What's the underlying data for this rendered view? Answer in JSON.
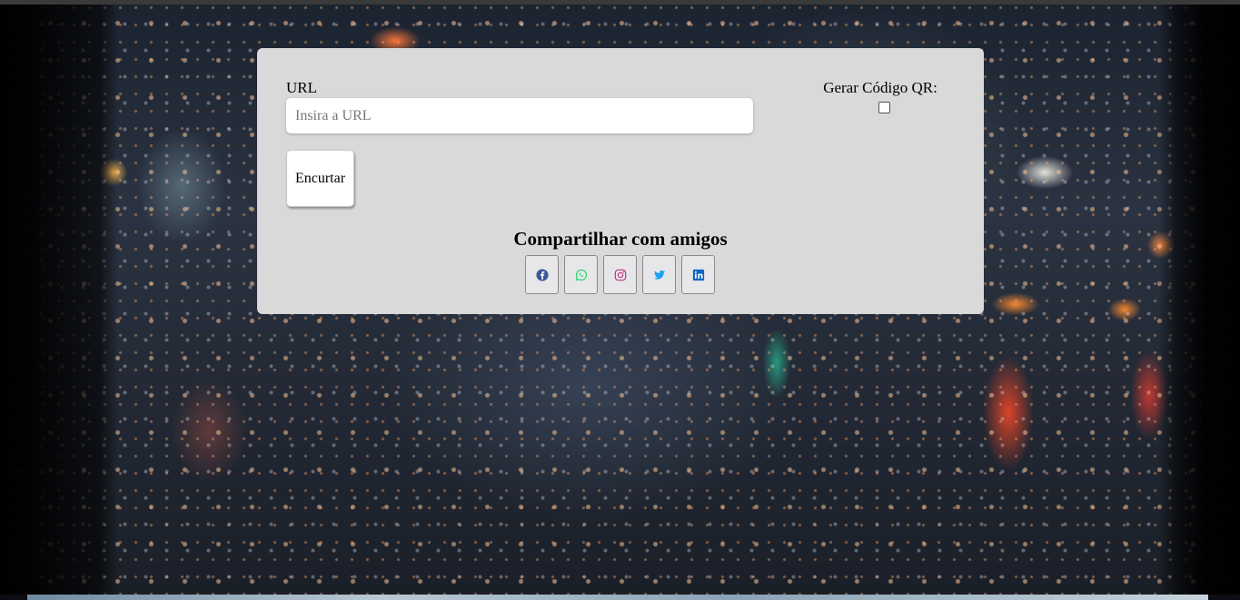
{
  "form": {
    "url_label": "URL",
    "url_placeholder": "Insira a URL",
    "url_value": "",
    "shorten_label": "Encurtar",
    "qr_label": "Gerar Código QR:",
    "qr_checked": false
  },
  "share": {
    "title": "Compartilhar com amigos",
    "buttons": [
      {
        "icon": "facebook-icon",
        "color": "#3b5998"
      },
      {
        "icon": "whatsapp-icon",
        "color": "#25d366"
      },
      {
        "icon": "instagram-icon",
        "color": "#c13584"
      },
      {
        "icon": "twitter-icon",
        "color": "#1da1f2"
      },
      {
        "icon": "linkedin-icon",
        "color": "#0a66c2"
      }
    ]
  },
  "colors": {
    "card_background": "#d9d9d9",
    "input_background": "#ffffff"
  }
}
